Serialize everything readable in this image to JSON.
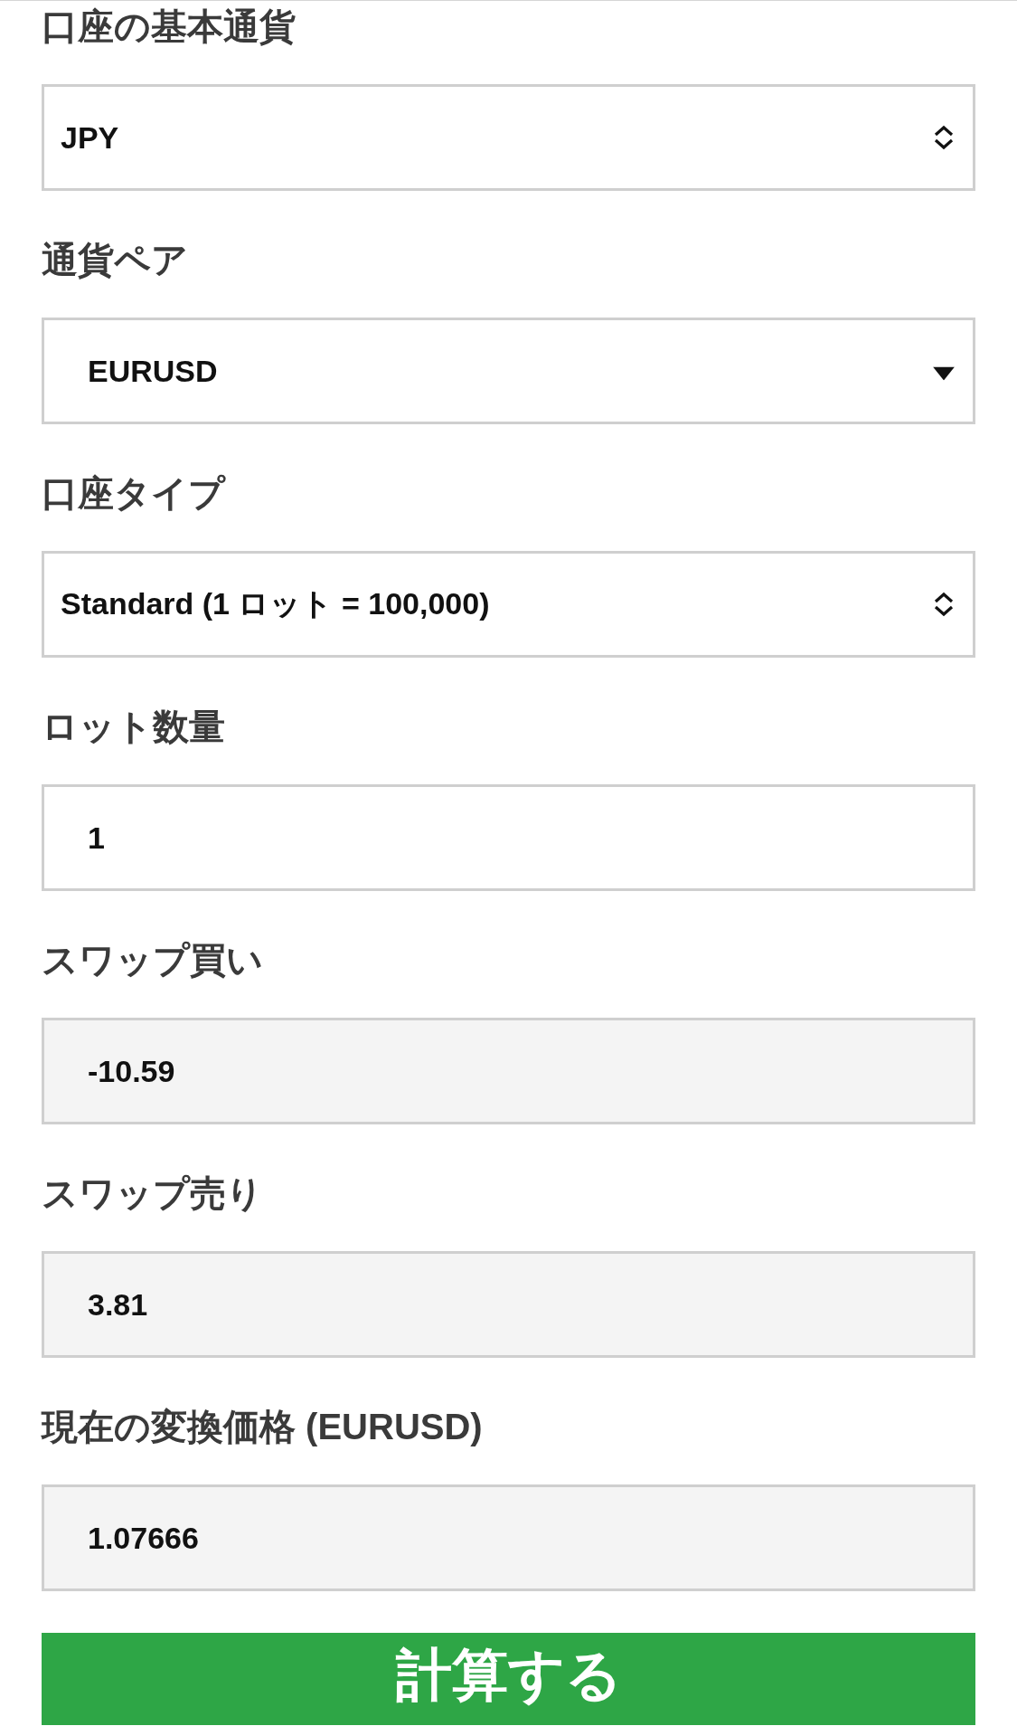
{
  "fields": [
    {
      "label": "口座の基本通貨",
      "kind": "select",
      "value": "JPY"
    },
    {
      "label": "通貨ペア",
      "kind": "dropdown",
      "value": "EURUSD"
    },
    {
      "label": "口座タイプ",
      "kind": "select",
      "value": "Standard (1 ロット = 100,000)"
    },
    {
      "label": "ロット数量",
      "kind": "input",
      "value": "1"
    },
    {
      "label": "スワップ買い",
      "kind": "output",
      "value": "-10.59"
    },
    {
      "label": "スワップ売り",
      "kind": "output",
      "value": "3.81"
    },
    {
      "label": "現在の変換価格 (EURUSD)",
      "kind": "output",
      "value": "1.07666"
    }
  ],
  "button": {
    "label": "計算する"
  }
}
